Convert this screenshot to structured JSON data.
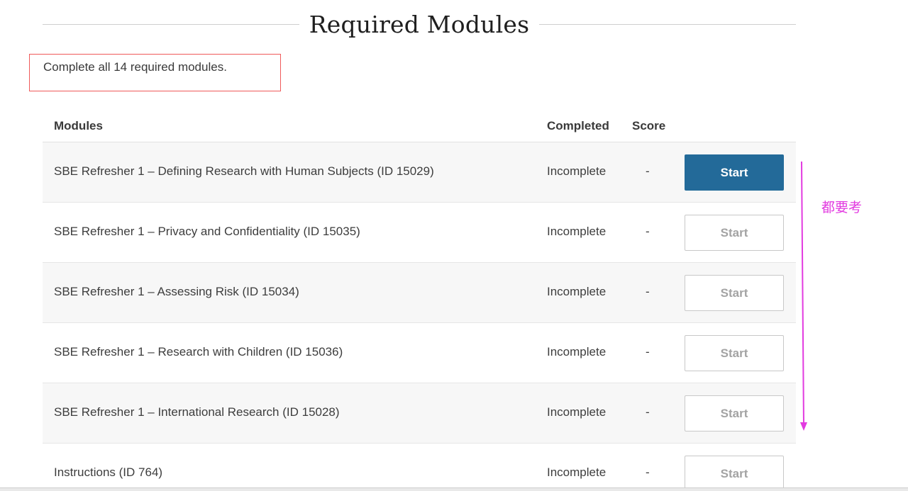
{
  "section": {
    "title": "Required Modules",
    "instruction": "Complete all 14 required modules."
  },
  "table": {
    "headers": {
      "modules": "Modules",
      "completed": "Completed",
      "score": "Score"
    },
    "rows": [
      {
        "name": "SBE Refresher 1 – Defining Research with Human Subjects (ID 15029)",
        "status": "Incomplete",
        "score": "-",
        "action": "Start"
      },
      {
        "name": "SBE Refresher 1 – Privacy and Confidentiality (ID 15035)",
        "status": "Incomplete",
        "score": "-",
        "action": "Start"
      },
      {
        "name": "SBE Refresher 1 – Assessing Risk (ID 15034)",
        "status": "Incomplete",
        "score": "-",
        "action": "Start"
      },
      {
        "name": "SBE Refresher 1 – Research with Children (ID 15036)",
        "status": "Incomplete",
        "score": "-",
        "action": "Start"
      },
      {
        "name": "SBE Refresher 1 – International Research (ID 15028)",
        "status": "Incomplete",
        "score": "-",
        "action": "Start"
      },
      {
        "name": "Instructions (ID 764)",
        "status": "Incomplete",
        "score": "-",
        "action": "Start"
      }
    ]
  },
  "annotation": {
    "label": "都要考",
    "color": "#e23be0"
  },
  "colors": {
    "primary_button": "#236a99",
    "highlight_border": "#ef5a5a"
  }
}
